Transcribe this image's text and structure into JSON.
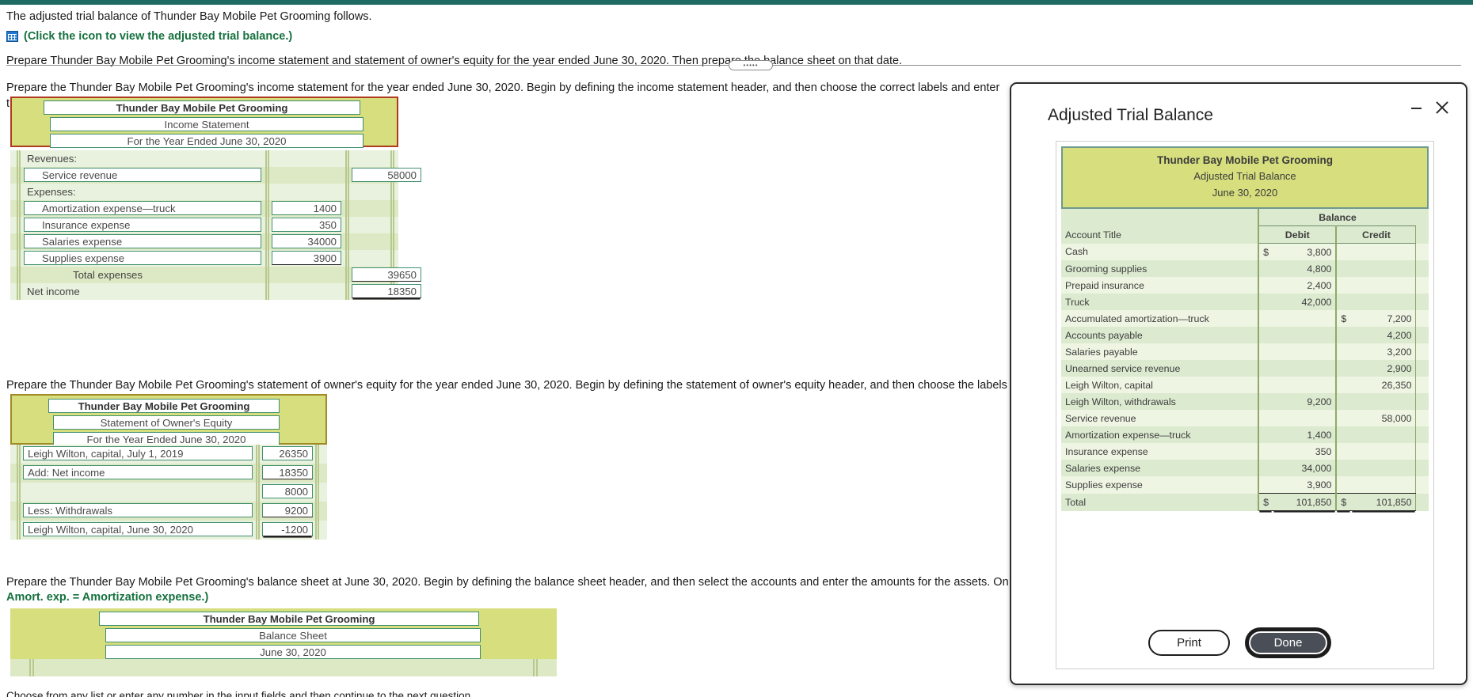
{
  "intro": {
    "line1": "The adjusted trial balance of Thunder Bay Mobile Pet Grooming follows.",
    "icon_label": "(Click the icon to view the adjusted trial balance.)",
    "icon_name": "grid-table-icon",
    "line2": "Prepare Thunder Bay Mobile Pet Grooming's income statement and statement of owner's equity for the year ended June 30, 2020. Then prepare the balance sheet on that date."
  },
  "income_statement": {
    "instruction": "Prepare the Thunder Bay Mobile Pet Grooming's income statement for the year ended June 30, 2020. Begin by defining the income statement header, and then choose the correct labels and enter the amounts.",
    "header": [
      "Thunder Bay Mobile Pet Grooming",
      "Income Statement",
      "For the Year Ended June 30, 2020"
    ],
    "rows": [
      {
        "label": "Revenues:",
        "kind": "plain",
        "amount_b": "",
        "amount_c": ""
      },
      {
        "label": "Service revenue",
        "kind": "input",
        "amount_b": "",
        "amount_c": "58000"
      },
      {
        "label": "Expenses:",
        "kind": "plain",
        "amount_b": "",
        "amount_c": ""
      },
      {
        "label": "Amortization expense—truck",
        "kind": "input",
        "amount_b": "1400",
        "amount_c": ""
      },
      {
        "label": "Insurance expense",
        "kind": "input",
        "amount_b": "350",
        "amount_c": ""
      },
      {
        "label": "Salaries expense",
        "kind": "input",
        "amount_b": "34000",
        "amount_c": ""
      },
      {
        "label": "Supplies expense",
        "kind": "input",
        "amount_b": "3900",
        "amount_c": "",
        "rule_b": "single"
      },
      {
        "label": "Total expenses",
        "kind": "static-center",
        "amount_b": "",
        "amount_c": "39650",
        "rule_c": "single"
      },
      {
        "label": "Net income",
        "kind": "plain",
        "amount_b": "",
        "amount_c": "18350",
        "rule_c": "double"
      }
    ]
  },
  "owners_equity": {
    "instruction": "Prepare the Thunder Bay Mobile Pet Grooming's statement of owner's equity for the year ended June 30, 2020. Begin by defining the statement of owner's equity header, and then choose the labels and enter the correspo",
    "header": [
      "Thunder Bay Mobile Pet Grooming",
      "Statement of Owner's Equity",
      "For the Year Ended June 30, 2020"
    ],
    "rows": [
      {
        "label": "Leigh Wilton, capital, July 1, 2019",
        "kind": "input",
        "amount": "26350",
        "rule": ""
      },
      {
        "label": "Add: Net income",
        "kind": "input",
        "amount": "18350",
        "rule": "single"
      },
      {
        "label": "",
        "kind": "blank",
        "amount": "8000",
        "rule": ""
      },
      {
        "label": "Less: Withdrawals",
        "kind": "input",
        "amount": "9200",
        "rule": "single"
      },
      {
        "label": "Leigh Wilton, capital, June 30, 2020",
        "kind": "input",
        "amount": "-1200",
        "rule": "double"
      }
    ]
  },
  "balance_sheet": {
    "instruction": "Prepare the Thunder Bay Mobile Pet Grooming's balance sheet at June 30, 2020. Begin by defining the balance sheet header, and then select the accounts and enter the amounts for the assets. Once the assets are comp",
    "abbrev_note": "Amort. exp. = Amortization expense.)",
    "header": [
      "Thunder Bay Mobile Pet Grooming",
      "Balance Sheet",
      "June 30, 2020"
    ]
  },
  "bottom_note": "Choose from any list or enter any number in the input fields and then continue to the next question.",
  "modal": {
    "title": "Adjusted Trial Balance",
    "minimize_icon": "minimize-icon",
    "close_icon": "close-icon",
    "sheet_header": [
      "Thunder Bay Mobile Pet Grooming",
      "Adjusted Trial Balance",
      "June 30, 2020"
    ],
    "group_header": "Balance",
    "columns": [
      "Account Title",
      "Debit",
      "Credit"
    ],
    "rows": [
      {
        "account": "Cash",
        "debit": "3,800",
        "credit": "",
        "debit_cur": "$",
        "credit_cur": ""
      },
      {
        "account": "Grooming supplies",
        "debit": "4,800",
        "credit": "",
        "debit_cur": "",
        "credit_cur": ""
      },
      {
        "account": "Prepaid insurance",
        "debit": "2,400",
        "credit": "",
        "debit_cur": "",
        "credit_cur": ""
      },
      {
        "account": "Truck",
        "debit": "42,000",
        "credit": "",
        "debit_cur": "",
        "credit_cur": ""
      },
      {
        "account": "Accumulated amortization—truck",
        "debit": "",
        "credit": "7,200",
        "debit_cur": "",
        "credit_cur": "$"
      },
      {
        "account": "Accounts payable",
        "debit": "",
        "credit": "4,200",
        "debit_cur": "",
        "credit_cur": ""
      },
      {
        "account": "Salaries payable",
        "debit": "",
        "credit": "3,200",
        "debit_cur": "",
        "credit_cur": ""
      },
      {
        "account": "Unearned service revenue",
        "debit": "",
        "credit": "2,900",
        "debit_cur": "",
        "credit_cur": ""
      },
      {
        "account": "Leigh Wilton, capital",
        "debit": "",
        "credit": "26,350",
        "debit_cur": "",
        "credit_cur": ""
      },
      {
        "account": "Leigh Wilton, withdrawals",
        "debit": "9,200",
        "credit": "",
        "debit_cur": "",
        "credit_cur": ""
      },
      {
        "account": "Service revenue",
        "debit": "",
        "credit": "58,000",
        "debit_cur": "",
        "credit_cur": ""
      },
      {
        "account": "Amortization expense—truck",
        "debit": "1,400",
        "credit": "",
        "debit_cur": "",
        "credit_cur": ""
      },
      {
        "account": "Insurance expense",
        "debit": "350",
        "credit": "",
        "debit_cur": "",
        "credit_cur": ""
      },
      {
        "account": "Salaries expense",
        "debit": "34,000",
        "credit": "",
        "debit_cur": "",
        "credit_cur": ""
      },
      {
        "account": "Supplies expense",
        "debit": "3,900",
        "credit": "",
        "debit_cur": "",
        "credit_cur": "",
        "rule": "single"
      },
      {
        "account": "Total",
        "debit": "101,850",
        "credit": "101,850",
        "debit_cur": "$",
        "credit_cur": "$",
        "rule": "double"
      }
    ],
    "print_label": "Print",
    "done_label": "Done"
  },
  "colors": {
    "accent_top": "#1f6b63",
    "header_band": "#d6de7d",
    "row_light": "#eef5e2",
    "row_dark": "#dcead0",
    "green_text": "#16713f",
    "red_outline": "#b03a1f"
  }
}
